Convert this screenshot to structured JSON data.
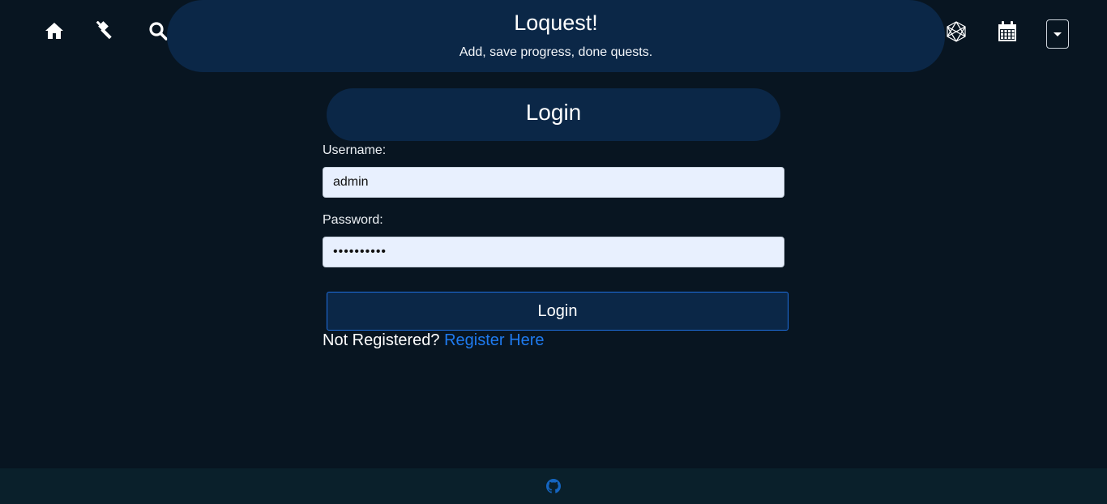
{
  "nav": {
    "left_icons": [
      "home-icon",
      "gavel-icon",
      "search-icon"
    ],
    "right_icons": [
      "hexagon-network-icon",
      "calendar-icon"
    ]
  },
  "header": {
    "title": "Loquest!",
    "subtitle": "Add, save progress, done quests."
  },
  "login": {
    "heading": "Login",
    "username_label": "Username:",
    "username_value": "admin",
    "password_label": "Password:",
    "password_value": "••••••••••",
    "submit_label": "Login",
    "register_prompt": "Not Registered?",
    "register_link": "Register Here"
  },
  "footer": {
    "icon": "github-icon"
  },
  "colors": {
    "background": "#081521",
    "banner": "#0b2747",
    "link": "#1f7bf0",
    "input_bg": "#e8f0fe",
    "footer": "#0a202b"
  }
}
